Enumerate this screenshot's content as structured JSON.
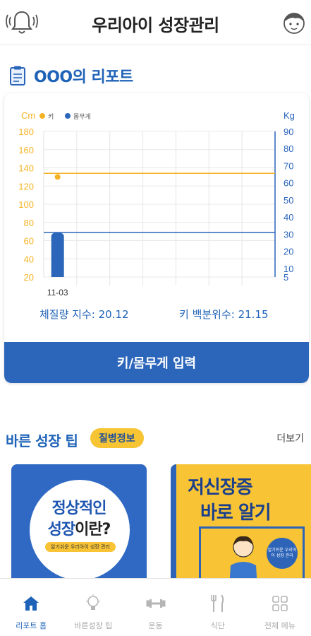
{
  "header": {
    "title": "우리아이 성장관리"
  },
  "report": {
    "title": "OOO의 리포트"
  },
  "chart_data": {
    "type": "bar",
    "categories": [
      "11-03"
    ],
    "left_axis": {
      "label": "Cm",
      "ticks": [
        20,
        40,
        60,
        80,
        100,
        120,
        140,
        160,
        180
      ],
      "ylim": [
        20,
        180
      ],
      "color": "#f5b324"
    },
    "right_axis": {
      "label": "Kg",
      "ticks": [
        5,
        10,
        20,
        30,
        40,
        50,
        60,
        70,
        80,
        90
      ],
      "ylim": [
        5,
        90
      ],
      "color": "#2c66bb"
    },
    "legend": [
      {
        "label": "키",
        "color": "#f5b324"
      },
      {
        "label": "몸무게",
        "color": "#2c66bb"
      }
    ],
    "series": [
      {
        "name": "키",
        "axis": "left",
        "kind": "point",
        "values": [
          130
        ],
        "reference": 134,
        "color": "#f5b324"
      },
      {
        "name": "몸무게",
        "axis": "right",
        "kind": "bar",
        "values": [
          31
        ],
        "reference": 31,
        "color": "#2c66bb"
      }
    ],
    "grid": true,
    "legend_position": "top-left"
  },
  "stats": {
    "bmi": "체질량 지수: 20.12",
    "height_percentile": "키 백분위수: 21.15"
  },
  "input_button": "키/몸무게 입력",
  "tips": {
    "title": "바른 성장 팁",
    "badge": "질병정보",
    "more": "더보기",
    "cards": [
      {
        "line1": "정상적인",
        "line2a": "성장",
        "line2b": "이란?",
        "sub": "알기쉬운 우리아이 성장 관리"
      },
      {
        "line1": "저신장증",
        "line2": "바로 알기",
        "sub": "알기쉬운 우리아이 성장 관리"
      }
    ]
  },
  "nav": [
    {
      "label": "리포트 홈",
      "icon": "home-icon",
      "active": true
    },
    {
      "label": "바른성장 팁",
      "icon": "lightbulb-icon",
      "active": false
    },
    {
      "label": "운동",
      "icon": "dumbbell-icon",
      "active": false
    },
    {
      "label": "식단",
      "icon": "fork-knife-icon",
      "active": false
    },
    {
      "label": "전체 메뉴",
      "icon": "grid-menu-icon",
      "active": false
    }
  ]
}
